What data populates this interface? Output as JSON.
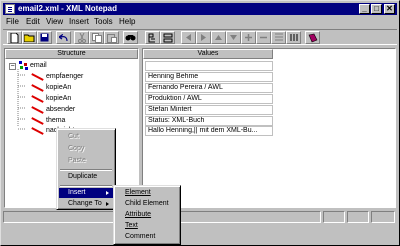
{
  "window": {
    "title": "email2.xml - XML Notepad",
    "buttons": [
      "_",
      "□",
      "✕"
    ]
  },
  "menubar": [
    {
      "label": "File"
    },
    {
      "label": "Edit"
    },
    {
      "label": "View"
    },
    {
      "label": "Insert"
    },
    {
      "label": "Tools"
    },
    {
      "label": "Help"
    }
  ],
  "toolbar": {
    "buttons": [
      "new-icon",
      "open-icon",
      "save-icon",
      "undo-icon",
      "cut-icon",
      "copy-icon",
      "paste-icon",
      "find-icon",
      "tree-view-icon",
      "source-view-icon",
      "move-left-icon",
      "move-right-icon",
      "move-up-icon",
      "move-down-icon",
      "add-icon",
      "remove-icon",
      "indent-icon",
      "outdent-icon",
      "book-icon"
    ]
  },
  "structure": {
    "header": "Structure",
    "root": "email",
    "children": [
      "empfaenger",
      "kopieAn",
      "kopieAn",
      "absender",
      "thema",
      "nachricht"
    ]
  },
  "values": {
    "header": "Values",
    "rows": [
      "",
      "Henning Behme",
      "Fernando Pereira / AWL",
      "Produktion / AWL",
      "Stefan Mintert",
      "Status: XML-Buch",
      "Hallo Henning,|| mit dem XML-Bu..."
    ]
  },
  "context_menu": {
    "items": [
      {
        "label": "Cut",
        "enabled": false
      },
      {
        "label": "Copy",
        "enabled": false
      },
      {
        "label": "Paste",
        "enabled": false
      },
      {
        "label": "Duplicate",
        "enabled": true
      },
      {
        "label": "Insert",
        "enabled": true,
        "submenu": true,
        "selected": true
      },
      {
        "label": "Change To",
        "enabled": true,
        "submenu": true
      }
    ]
  },
  "submenu": {
    "items": [
      "Element",
      "Child Element",
      "Attribute",
      "Text",
      "Comment"
    ]
  },
  "colors": {
    "titlebar": "#000080",
    "face": "#c0c0c0",
    "element_icon": "#d00000",
    "selection": "#000080"
  }
}
